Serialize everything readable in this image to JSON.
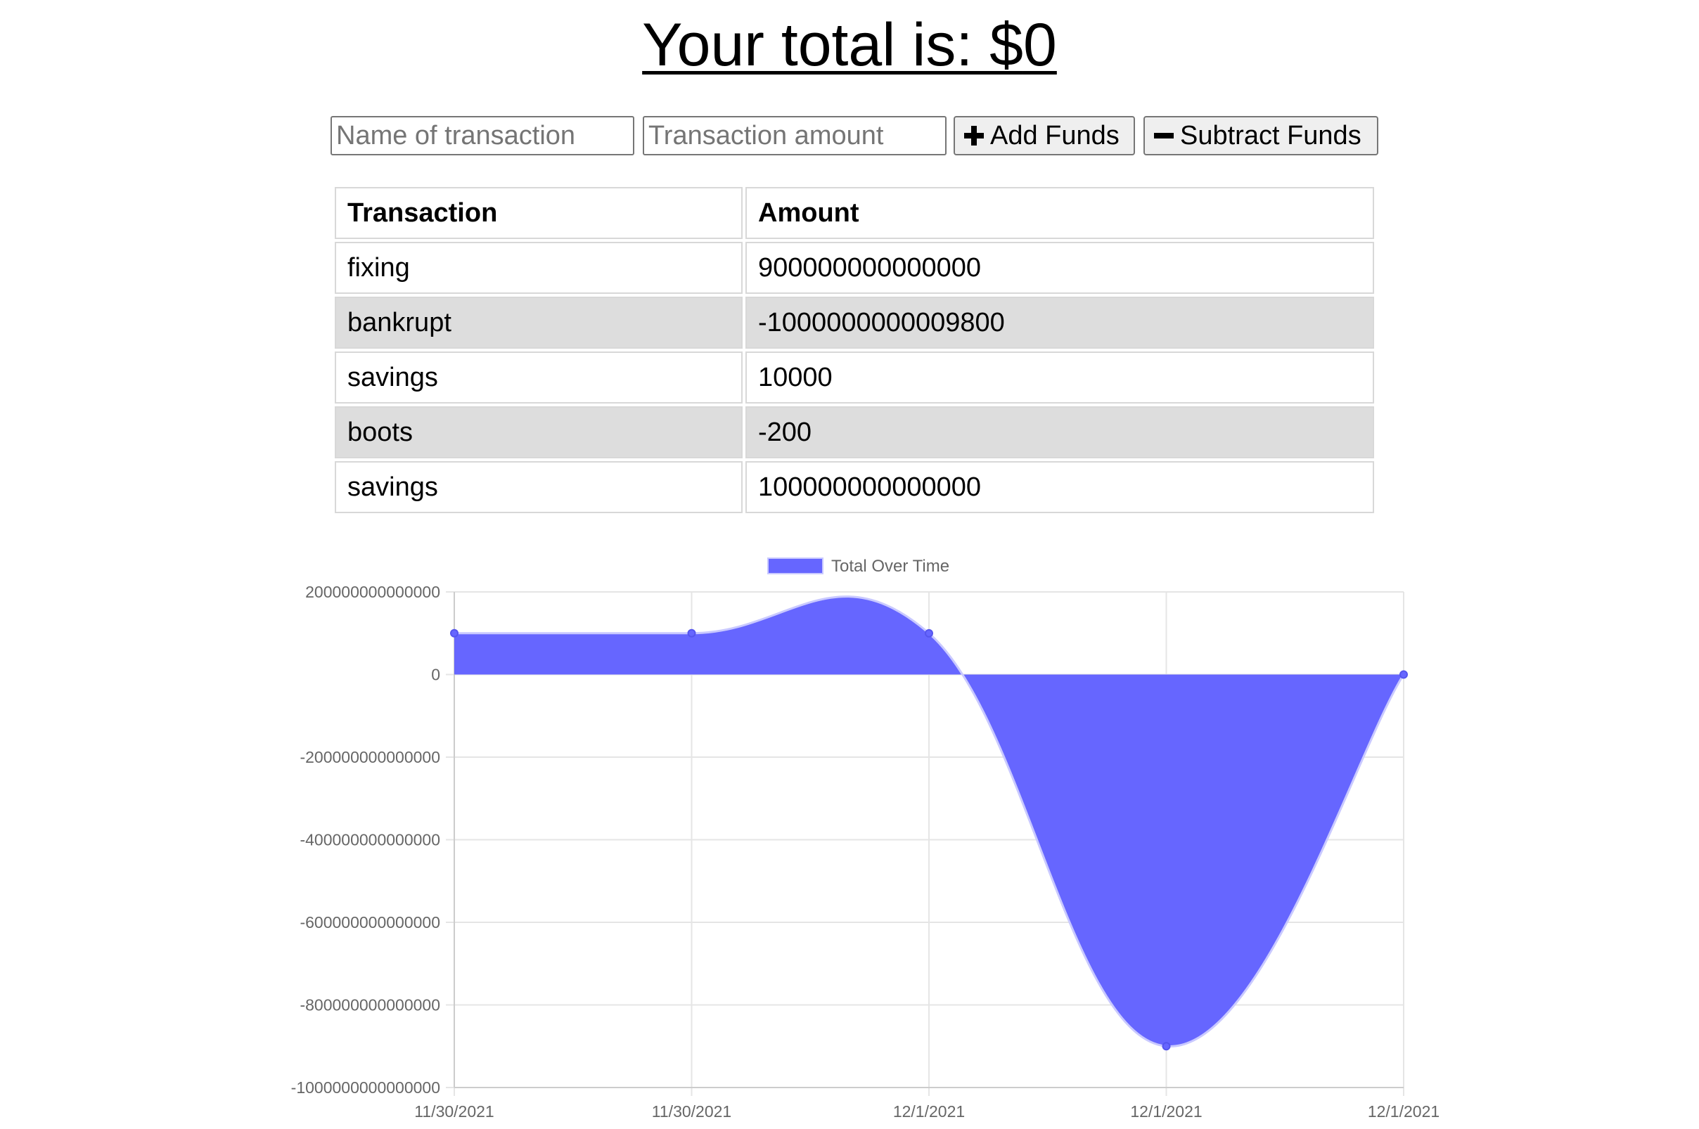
{
  "header": {
    "total_prefix": "Your total is: $",
    "total_value": "0"
  },
  "form": {
    "name_placeholder": "Name of transaction",
    "amount_placeholder": "Transaction amount",
    "add_label": "Add Funds",
    "subtract_label": "Subtract Funds"
  },
  "table": {
    "headers": [
      "Transaction",
      "Amount"
    ],
    "rows": [
      {
        "name": "fixing",
        "amount": "900000000000000"
      },
      {
        "name": "bankrupt",
        "amount": "-1000000000009800"
      },
      {
        "name": "savings",
        "amount": "10000"
      },
      {
        "name": "boots",
        "amount": "-200"
      },
      {
        "name": "savings",
        "amount": "100000000000000"
      }
    ]
  },
  "colors": {
    "series_fill": "#6666ff",
    "grid": "#e5e5e5",
    "axis_text": "#666666"
  },
  "chart_data": {
    "type": "area",
    "x": [
      "11/30/2021",
      "11/30/2021",
      "12/1/2021",
      "12/1/2021",
      "12/1/2021"
    ],
    "series": [
      {
        "name": "Total Over Time",
        "values": [
          100000000000000,
          100010000000000,
          99809800000000,
          -900000000000000,
          0
        ]
      }
    ],
    "ylim": [
      -1000000000000000,
      200000000000000
    ],
    "yticks": [
      "200000000000000",
      "0",
      "-200000000000000",
      "-400000000000000",
      "-600000000000000",
      "-800000000000000",
      "-1000000000000000"
    ],
    "legend_position": "top",
    "grid": true
  }
}
